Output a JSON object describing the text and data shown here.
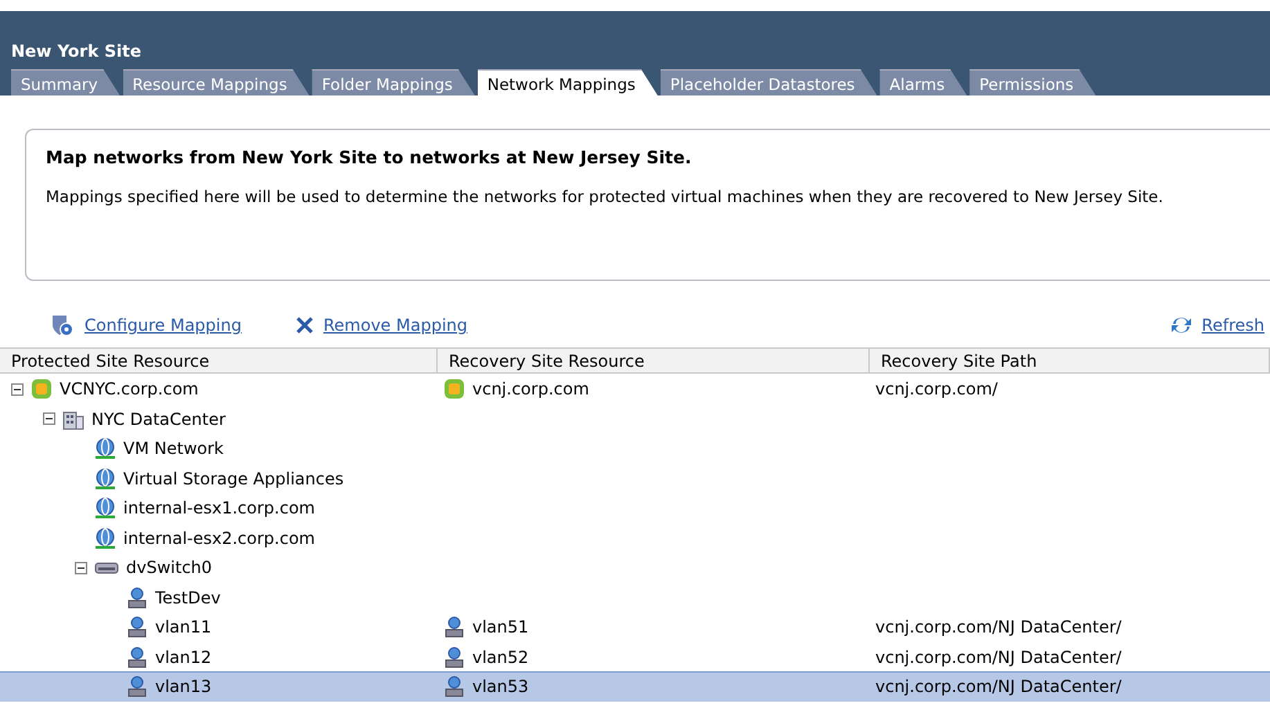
{
  "header": {
    "title": "New York Site"
  },
  "tabs": [
    {
      "label": "Summary",
      "selected": false
    },
    {
      "label": "Resource Mappings",
      "selected": false
    },
    {
      "label": "Folder Mappings",
      "selected": false
    },
    {
      "label": "Network Mappings",
      "selected": true
    },
    {
      "label": "Placeholder Datastores",
      "selected": false
    },
    {
      "label": "Alarms",
      "selected": false
    },
    {
      "label": "Permissions",
      "selected": false
    }
  ],
  "info": {
    "heading": "Map networks from New York Site to networks at New Jersey Site.",
    "text": "Mappings specified here will be used to determine the networks for protected virtual machines when they are recovered to New Jersey Site."
  },
  "toolbar": {
    "configure": "Configure Mapping",
    "remove": "Remove Mapping",
    "refresh": "Refresh"
  },
  "table": {
    "columns": [
      "Protected Site Resource",
      "Recovery Site Resource",
      "Recovery Site Path"
    ],
    "rows": [
      {
        "name": "VCNYC.corp.com",
        "kind": "vcenter",
        "expanded": true,
        "selected": false,
        "recovery": {
          "name": "vcnj.corp.com",
          "kind": "vcenter"
        },
        "path": "vcnj.corp.com/",
        "children": [
          {
            "name": "NYC DataCenter",
            "kind": "datacenter",
            "expanded": true,
            "selected": false,
            "children": [
              {
                "name": "VM Network",
                "kind": "network",
                "selected": false
              },
              {
                "name": "Virtual Storage Appliances",
                "kind": "network",
                "selected": false
              },
              {
                "name": "internal-esx1.corp.com",
                "kind": "network",
                "selected": false
              },
              {
                "name": "internal-esx2.corp.com",
                "kind": "network",
                "selected": false
              },
              {
                "name": "dvSwitch0",
                "kind": "switch",
                "expanded": true,
                "selected": false,
                "children": [
                  {
                    "name": "TestDev",
                    "kind": "portgroup",
                    "selected": false
                  },
                  {
                    "name": "vlan11",
                    "kind": "portgroup",
                    "selected": false,
                    "recovery": {
                      "name": "vlan51",
                      "kind": "portgroup"
                    },
                    "path": "vcnj.corp.com/NJ DataCenter/"
                  },
                  {
                    "name": "vlan12",
                    "kind": "portgroup",
                    "selected": false,
                    "recovery": {
                      "name": "vlan52",
                      "kind": "portgroup"
                    },
                    "path": "vcnj.corp.com/NJ DataCenter/"
                  },
                  {
                    "name": "vlan13",
                    "kind": "portgroup",
                    "selected": true,
                    "recovery": {
                      "name": "vlan53",
                      "kind": "portgroup"
                    },
                    "path": "vcnj.corp.com/NJ DataCenter/"
                  }
                ]
              }
            ]
          }
        ]
      }
    ]
  }
}
